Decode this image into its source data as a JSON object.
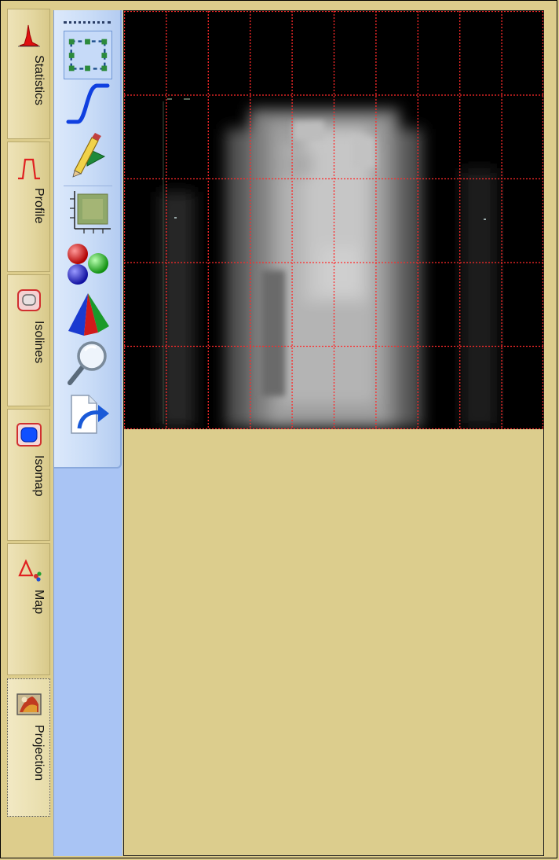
{
  "tabs": [
    {
      "id": "statistics",
      "label": "Statistics",
      "icon": "statistics-icon",
      "active": false
    },
    {
      "id": "profile",
      "label": "Profile",
      "icon": "profile-icon",
      "active": false
    },
    {
      "id": "isolines",
      "label": "Isolines",
      "icon": "isolines-icon",
      "active": false
    },
    {
      "id": "isomap",
      "label": "Isomap",
      "icon": "isomap-icon",
      "active": false
    },
    {
      "id": "map",
      "label": "Map",
      "icon": "map-icon",
      "active": false
    },
    {
      "id": "projection",
      "label": "Projection",
      "icon": "projection-icon",
      "active": true
    }
  ],
  "toolbar": {
    "tools": [
      {
        "icon": "selection-rectangle-icon",
        "selected": true
      },
      {
        "icon": "curve-icon",
        "selected": false
      },
      {
        "icon": "pencil-draw-icon",
        "selected": false
      },
      {
        "icon": "axis-scale-icon",
        "selected": false
      },
      {
        "icon": "color-spheres-icon",
        "selected": false
      },
      {
        "icon": "cone-3d-icon",
        "selected": false
      },
      {
        "icon": "zoom-magnifier-icon",
        "selected": false
      },
      {
        "icon": "export-icon",
        "selected": false
      }
    ]
  },
  "colors": {
    "panel_background": "#ddcd8c",
    "toolbar_blue": "#a9c4f4",
    "grid_line": "#ff2a2a",
    "image_background": "#000000"
  },
  "view": {
    "grid": "on",
    "grid_columns": 10,
    "grid_rows": 5
  }
}
